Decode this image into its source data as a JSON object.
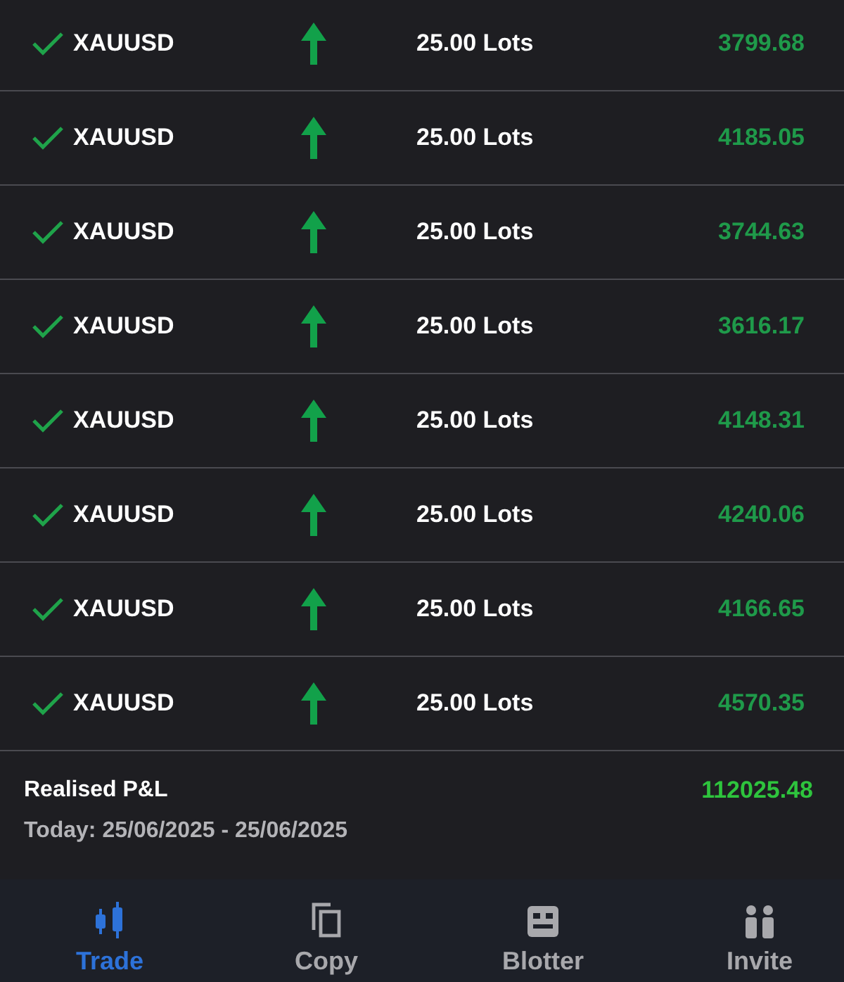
{
  "trades": [
    {
      "closed": true,
      "up": true,
      "symbol": "XAUUSD",
      "volume": "25.00 Lots",
      "profit": "3799.68"
    },
    {
      "closed": true,
      "up": true,
      "symbol": "XAUUSD",
      "volume": "25.00 Lots",
      "profit": "4185.05"
    },
    {
      "closed": true,
      "up": true,
      "symbol": "XAUUSD",
      "volume": "25.00 Lots",
      "profit": "3744.63"
    },
    {
      "closed": true,
      "up": true,
      "symbol": "XAUUSD",
      "volume": "25.00 Lots",
      "profit": "3616.17"
    },
    {
      "closed": true,
      "up": true,
      "symbol": "XAUUSD",
      "volume": "25.00 Lots",
      "profit": "4148.31"
    },
    {
      "closed": true,
      "up": true,
      "symbol": "XAUUSD",
      "volume": "25.00 Lots",
      "profit": "4240.06"
    },
    {
      "closed": true,
      "up": true,
      "symbol": "XAUUSD",
      "volume": "25.00 Lots",
      "profit": "4166.65"
    },
    {
      "closed": true,
      "up": true,
      "symbol": "XAUUSD",
      "volume": "25.00 Lots",
      "profit": "4570.35"
    }
  ],
  "summary": {
    "label": "Realised P&L",
    "value": "112025.48",
    "period": "Today: 25/06/2025 - 25/06/2025"
  },
  "nav": [
    {
      "kind": "trade",
      "label": "Trade",
      "selected": true
    },
    {
      "kind": "copy",
      "label": "Copy",
      "selected": false
    },
    {
      "kind": "blotter",
      "label": "Blotter",
      "selected": false
    },
    {
      "kind": "invite",
      "label": "Invite",
      "selected": false
    }
  ]
}
